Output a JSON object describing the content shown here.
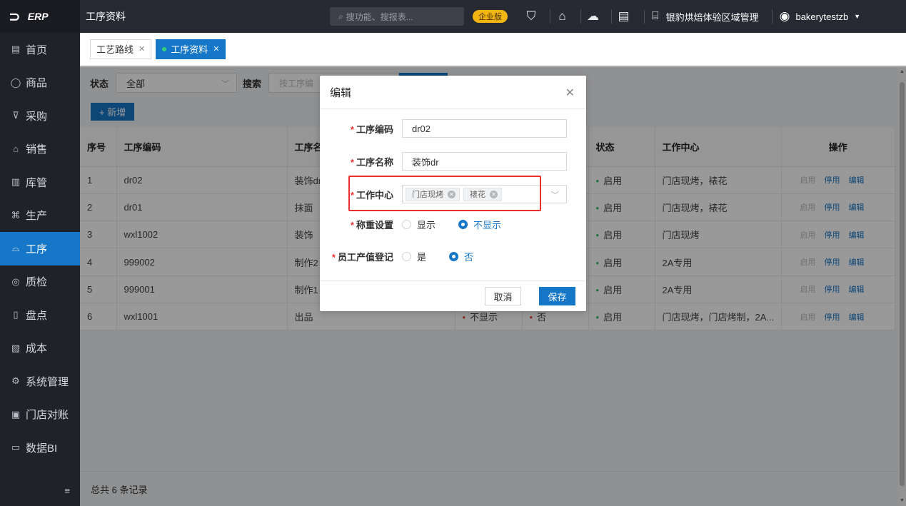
{
  "app": {
    "logo_text": "ERP"
  },
  "sidebar": {
    "items": [
      {
        "icon": "▤",
        "label": "首页"
      },
      {
        "icon": "◯",
        "label": "商品"
      },
      {
        "icon": "⊽",
        "label": "采购"
      },
      {
        "icon": "⌂",
        "label": "销售"
      },
      {
        "icon": "▥",
        "label": "库管"
      },
      {
        "icon": "⌘",
        "label": "生产"
      },
      {
        "icon": "⌓",
        "label": "工序"
      },
      {
        "icon": "◎",
        "label": "质检"
      },
      {
        "icon": "▯",
        "label": "盘点"
      },
      {
        "icon": "▧",
        "label": "成本"
      },
      {
        "icon": "⚙",
        "label": "系统管理"
      },
      {
        "icon": "▣",
        "label": "门店对账"
      },
      {
        "icon": "▭",
        "label": "数据BI"
      }
    ],
    "collapse_icon": "≡"
  },
  "header": {
    "title": "工序资料",
    "search_placeholder": "搜功能、搜报表...",
    "edition_badge": "企业版",
    "store_name": "银豹烘焙体验区域管理",
    "username": "bakerytestzb"
  },
  "tabs": [
    {
      "label": "工艺路线"
    },
    {
      "label": "工序资料"
    }
  ],
  "filter": {
    "status_label": "状态",
    "status_value": "全部",
    "search_label": "搜索",
    "search_placeholder": "按工序编",
    "add_button": "+ 新增"
  },
  "table": {
    "columns": [
      "序号",
      "工序编码",
      "工序名",
      "",
      "",
      "状态",
      "工作中心",
      "操作"
    ],
    "rows": [
      {
        "no": "1",
        "code": "dr02",
        "name": "装饰dr",
        "c4": "",
        "c5": "",
        "status": "启用",
        "center": "门店现烤，裱花"
      },
      {
        "no": "2",
        "code": "dr01",
        "name": "抹面",
        "c4": "",
        "c5": "",
        "status": "启用",
        "center": "门店现烤，裱花"
      },
      {
        "no": "3",
        "code": "wxl1002",
        "name": "装饰",
        "c4": "",
        "c5": "",
        "status": "启用",
        "center": "门店现烤"
      },
      {
        "no": "4",
        "code": "999002",
        "name": "制作2",
        "c4": "",
        "c5": "",
        "status": "启用",
        "center": "2A专用"
      },
      {
        "no": "5",
        "code": "999001",
        "name": "制作1",
        "c4": "",
        "c5": "",
        "status": "启用",
        "center": "2A专用"
      },
      {
        "no": "6",
        "code": "wxl1001",
        "name": "出品",
        "c4": "不显示",
        "c5": "否",
        "status": "启用",
        "center": "门店现烤，门店烤制，2A..."
      }
    ],
    "ops": {
      "enable": "启用",
      "disable": "停用",
      "edit": "编辑"
    }
  },
  "footer": {
    "summary": "总共 6 条记录"
  },
  "modal": {
    "title": "编辑",
    "fields": {
      "code_label": "工序编码",
      "code_value": "dr02",
      "name_label": "工序名称",
      "name_value": "装饰dr",
      "center_label": "工作中心",
      "center_tags": [
        "门店现烤",
        "裱花"
      ],
      "weigh_label": "称重设置",
      "weigh_options": [
        "显示",
        "不显示"
      ],
      "weigh_selected": "不显示",
      "output_label": "员工产值登记",
      "output_options": [
        "是",
        "否"
      ],
      "output_selected": "否"
    },
    "cancel_label": "取消",
    "save_label": "保存"
  }
}
